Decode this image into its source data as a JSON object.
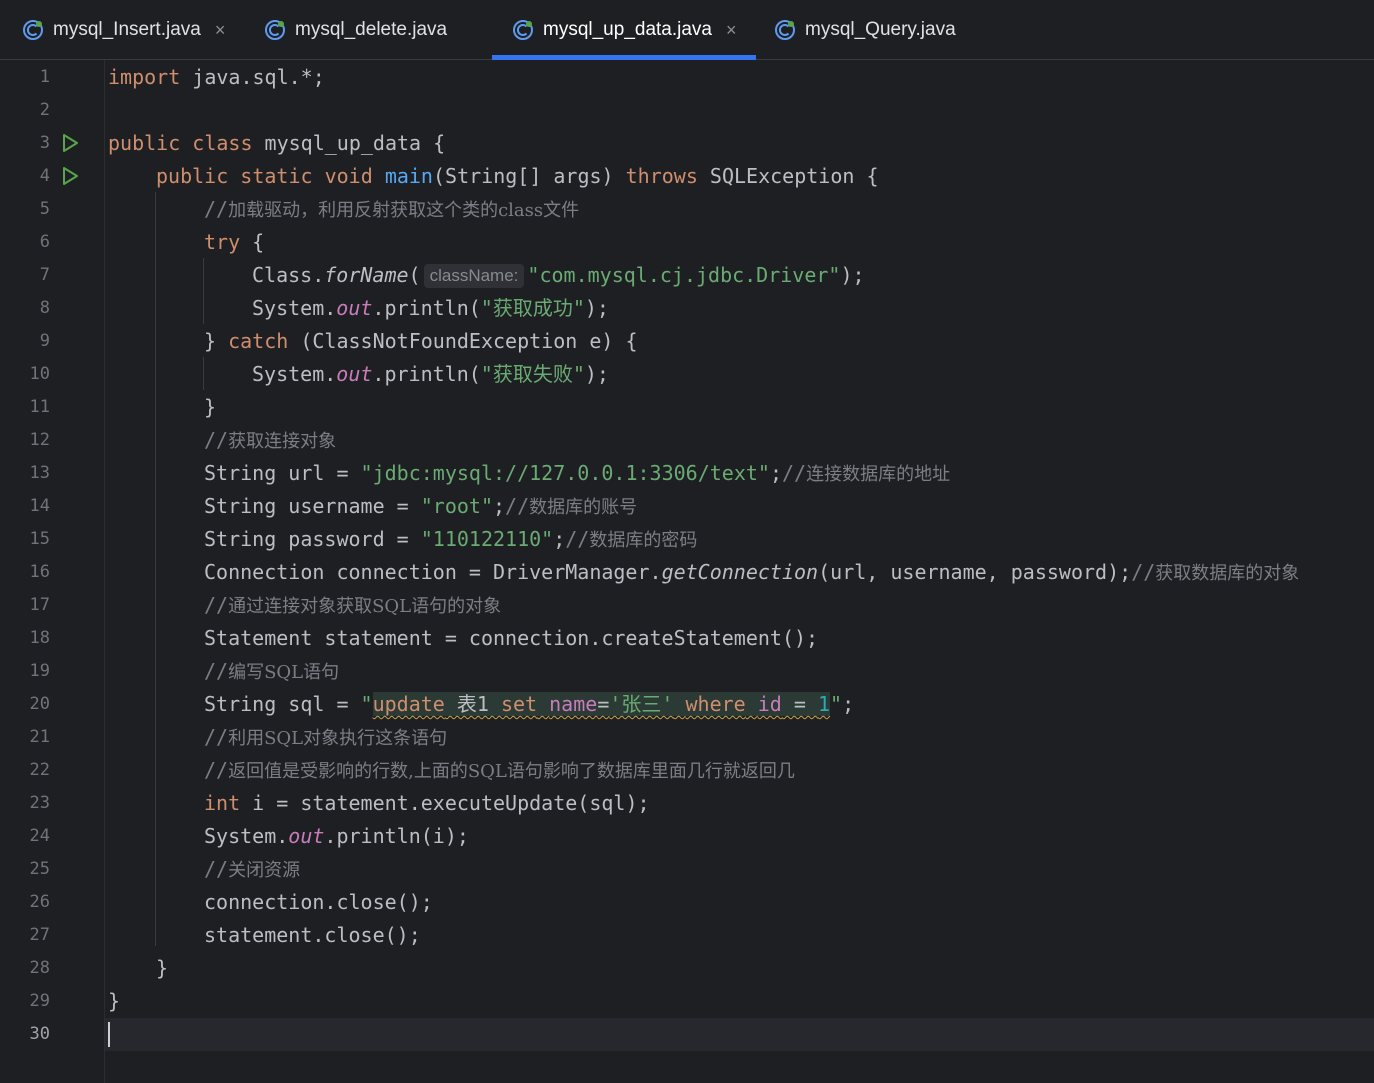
{
  "tabs": [
    {
      "label": "mysql_Insert.java",
      "closable": true,
      "active": false
    },
    {
      "label": "mysql_delete.java",
      "closable": false,
      "active": false
    },
    {
      "label": "mysql_up_data.java",
      "closable": true,
      "active": true
    },
    {
      "label": "mysql_Query.java",
      "closable": false,
      "active": false
    }
  ],
  "close_glyph": "×",
  "colors": {
    "accent": "#3574f0",
    "keyword": "#cf8e6d",
    "string": "#6aab73",
    "comment": "#7a7e85",
    "method": "#56a8f5",
    "static_field": "#c77dbb"
  },
  "line_numbers": [
    "1",
    "2",
    "3",
    "4",
    "5",
    "6",
    "7",
    "8",
    "9",
    "10",
    "11",
    "12",
    "13",
    "14",
    "15",
    "16",
    "17",
    "18",
    "19",
    "20",
    "21",
    "22",
    "23",
    "24",
    "25",
    "26",
    "27",
    "28",
    "29",
    "30"
  ],
  "run_gutter_lines": [
    3,
    4
  ],
  "current_line": 30,
  "code": {
    "l1": {
      "kw": "import",
      "rest": " java.sql.*;"
    },
    "l3": {
      "kw1": "public",
      "kw2": "class",
      "rest": " mysql_up_data {"
    },
    "l4": {
      "kw1": "public",
      "kw2": "static",
      "kw3": "void",
      "fn": "main",
      "mid": "(String[] args) ",
      "kw4": "throws",
      "rest": " SQLException {"
    },
    "l5": {
      "comment_prefix": "//",
      "comment": "加载驱动，利用反射获取这个类的class文件"
    },
    "l6": {
      "kw": "try",
      "rest": " {"
    },
    "l7": {
      "pre": "Class.",
      "method": "forName",
      "open": "(",
      "hint": "className:",
      "str": "\"com.mysql.cj.jdbc.Driver\"",
      "close": ");"
    },
    "l8": {
      "pre": "System.",
      "field": "out",
      "mid": ".println(",
      "str": "\"获取成功\"",
      "close": ");"
    },
    "l9": {
      "pre": "} ",
      "kw": "catch",
      "rest": " (ClassNotFoundException e) {"
    },
    "l10": {
      "pre": "System.",
      "field": "out",
      "mid": ".println(",
      "str": "\"获取失败\"",
      "close": ");"
    },
    "l11": {
      "text": "}"
    },
    "l12": {
      "comment_prefix": "//",
      "comment": "获取连接对象"
    },
    "l13": {
      "pre": "String url = ",
      "str": "\"jdbc:mysql://127.0.0.1:3306/text\"",
      "post": ";",
      "comment_prefix": "//",
      "comment": "连接数据库的地址"
    },
    "l14": {
      "pre": "String username = ",
      "str": "\"root\"",
      "post": ";",
      "comment_prefix": "//",
      "comment": "数据库的账号"
    },
    "l15": {
      "pre": "String password = ",
      "str": "\"110122110\"",
      "post": ";",
      "comment_prefix": "//",
      "comment": "数据库的密码"
    },
    "l16": {
      "pre": "Connection connection = DriverManager.",
      "method": "getConnection",
      "args": "(url, username, password);",
      "comment_prefix": "//",
      "comment": "获取数据库的对象"
    },
    "l17": {
      "comment_prefix": "//",
      "comment": "通过连接对象获取SQL语句的对象"
    },
    "l18": {
      "text": "Statement statement = connection.createStatement();"
    },
    "l19": {
      "comment_prefix": "//",
      "comment": "编写SQL语句"
    },
    "l20": {
      "pre": "String sql = ",
      "q1": "\"",
      "update": "update",
      "table": " 表1 ",
      "set": "set",
      "sp1": " ",
      "name": "name",
      "eq": "=",
      "val": "'张三'",
      "sp2": " ",
      "where": "where",
      "sp3": " ",
      "id": "id",
      "op": " = ",
      "num": "1",
      "q2": "\"",
      "post": ";"
    },
    "l21": {
      "comment_prefix": "//",
      "comment": "利用SQL对象执行这条语句"
    },
    "l22": {
      "comment_prefix": "//",
      "comment": "返回值是受影响的行数,上面的SQL语句影响了数据库里面几行就返回几"
    },
    "l23": {
      "kw": "int",
      "rest": " i = statement.executeUpdate(sql);"
    },
    "l24": {
      "pre": "System.",
      "field": "out",
      "rest": ".println(i);"
    },
    "l25": {
      "comment_prefix": "//",
      "comment": "关闭资源"
    },
    "l26": {
      "text": "connection.close();"
    },
    "l27": {
      "text": "statement.close();"
    },
    "l28": {
      "text": "}"
    },
    "l29": {
      "text": "}"
    }
  }
}
